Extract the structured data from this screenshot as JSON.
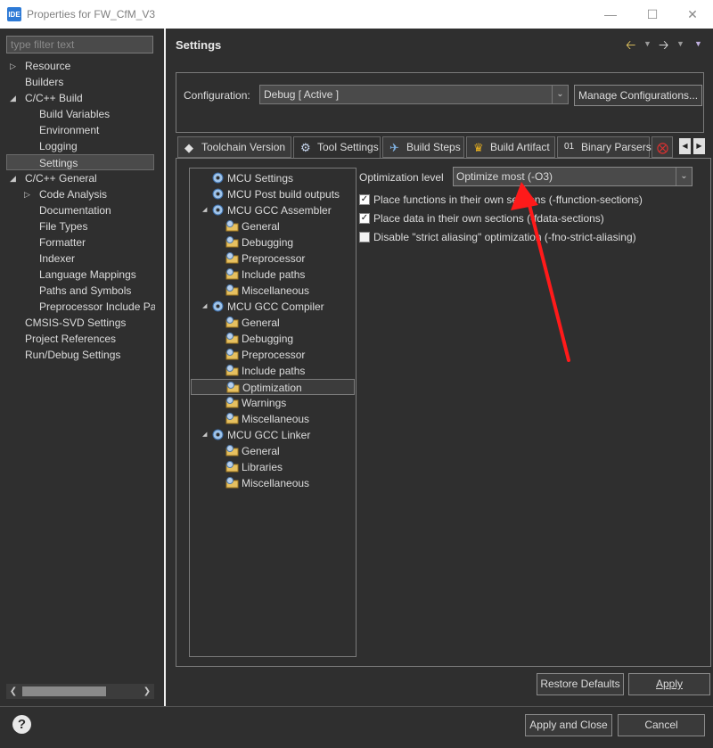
{
  "window": {
    "app_icon": "IDE",
    "title": "Properties for FW_CfM_V3",
    "minimize_icon": "minimize-icon",
    "maximize_icon": "maximize-icon",
    "close_icon": "close-icon"
  },
  "sidebar": {
    "filter_placeholder": "type filter text",
    "items": [
      {
        "label": "Resource",
        "expand": "collapsed"
      },
      {
        "label": "Builders"
      },
      {
        "label": "C/C++ Build",
        "expand": "expanded"
      },
      {
        "label": "Build Variables"
      },
      {
        "label": "Environment"
      },
      {
        "label": "Logging"
      },
      {
        "label": "Settings",
        "selected": true
      },
      {
        "label": "C/C++ General",
        "expand": "expanded"
      },
      {
        "label": "Code Analysis",
        "expand": "collapsed"
      },
      {
        "label": "Documentation"
      },
      {
        "label": "File Types"
      },
      {
        "label": "Formatter"
      },
      {
        "label": "Indexer"
      },
      {
        "label": "Language Mappings"
      },
      {
        "label": "Paths and Symbols"
      },
      {
        "label": "Preprocessor Include Pat"
      },
      {
        "label": "CMSIS-SVD Settings"
      },
      {
        "label": "Project References"
      },
      {
        "label": "Run/Debug Settings"
      }
    ]
  },
  "main": {
    "title": "Settings",
    "configuration_label": "Configuration:",
    "configuration_value": "Debug  [ Active ]",
    "manage_button": "Manage Configurations...",
    "tabs": [
      {
        "label": "Toolchain  Version",
        "icon": "chip-icon"
      },
      {
        "label": "Tool Settings",
        "icon": "gear-icon",
        "active": true
      },
      {
        "label": "Build Steps",
        "icon": "steps-icon"
      },
      {
        "label": "Build Artifact",
        "icon": "trophy-icon"
      },
      {
        "label": "Binary Parsers",
        "icon": "binary-icon"
      }
    ],
    "tool_tree": [
      {
        "label": "MCU Settings"
      },
      {
        "label": "MCU Post build outputs"
      },
      {
        "label": "MCU GCC Assembler",
        "expand": "expanded"
      },
      {
        "label": "General"
      },
      {
        "label": "Debugging"
      },
      {
        "label": "Preprocessor"
      },
      {
        "label": "Include paths"
      },
      {
        "label": "Miscellaneous"
      },
      {
        "label": "MCU GCC Compiler",
        "expand": "expanded"
      },
      {
        "label": "General"
      },
      {
        "label": "Debugging"
      },
      {
        "label": "Preprocessor"
      },
      {
        "label": "Include paths"
      },
      {
        "label": "Optimization",
        "selected": true
      },
      {
        "label": "Warnings"
      },
      {
        "label": "Miscellaneous"
      },
      {
        "label": "MCU GCC Linker",
        "expand": "expanded"
      },
      {
        "label": "General"
      },
      {
        "label": "Libraries"
      },
      {
        "label": "Miscellaneous"
      }
    ],
    "optimization_label": "Optimization level",
    "optimization_value": "Optimize most (-O3)",
    "options": [
      {
        "label": "Place functions in their own sections (-ffunction-sections)",
        "checked": true
      },
      {
        "label": "Place data in their own sections (-fdata-sections)",
        "checked": true
      },
      {
        "label": "Disable \"strict aliasing\" optimization (-fno-strict-aliasing)",
        "checked": false
      }
    ],
    "restore_defaults": "Restore Defaults",
    "apply": "Apply"
  },
  "footer": {
    "help_icon": "?",
    "apply_and_close": "Apply and Close",
    "cancel": "Cancel"
  },
  "colors": {
    "background": "#2f2f2f",
    "annotation_arrow": "#ff1a1a",
    "title_bar": "#ffffff"
  }
}
